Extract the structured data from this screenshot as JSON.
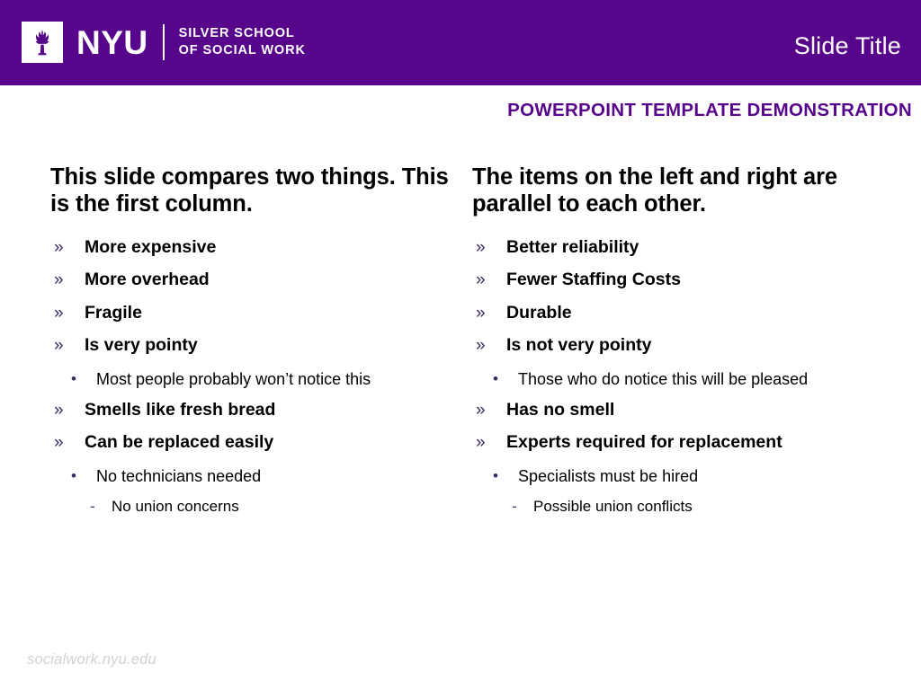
{
  "header": {
    "brand_word": "NYU",
    "school_line1": "SILVER SCHOOL",
    "school_line2": "OF SOCIAL WORK",
    "slide_title": "Slide Title",
    "bar_color": "#57068C"
  },
  "subtitle": "POWERPOINT TEMPLATE DEMONSTRATION",
  "columns": {
    "left": {
      "heading": "This slide compares two things. This is the first column.",
      "items": [
        {
          "level": 1,
          "marker": "»",
          "text": "More expensive"
        },
        {
          "level": 1,
          "marker": "»",
          "text": "More overhead"
        },
        {
          "level": 1,
          "marker": "»",
          "text": "Fragile"
        },
        {
          "level": 1,
          "marker": "»",
          "text": "Is very pointy"
        },
        {
          "level": 2,
          "marker": "•",
          "text": "Most people probably won’t notice this"
        },
        {
          "level": 1,
          "marker": "»",
          "text": "Smells like fresh bread"
        },
        {
          "level": 1,
          "marker": "»",
          "text": "Can be replaced easily"
        },
        {
          "level": 2,
          "marker": "•",
          "text": "No technicians needed"
        },
        {
          "level": 3,
          "marker": "-",
          "text": "No union concerns"
        }
      ]
    },
    "right": {
      "heading": "The items on the left and right are parallel to each other.",
      "items": [
        {
          "level": 1,
          "marker": "»",
          "text": "Better reliability"
        },
        {
          "level": 1,
          "marker": "»",
          "text": "Fewer Staffing Costs"
        },
        {
          "level": 1,
          "marker": "»",
          "text": "Durable"
        },
        {
          "level": 1,
          "marker": "»",
          "text": "Is not very pointy"
        },
        {
          "level": 2,
          "marker": "•",
          "text": "Those who do notice this will be pleased"
        },
        {
          "level": 1,
          "marker": "»",
          "text": "Has no smell"
        },
        {
          "level": 1,
          "marker": "»",
          "text": "Experts required for replacement"
        },
        {
          "level": 2,
          "marker": "•",
          "text": "Specialists must be hired"
        },
        {
          "level": 3,
          "marker": "-",
          "text": "Possible union conflicts"
        }
      ]
    }
  },
  "footer": {
    "url": "socialwork.nyu.edu"
  },
  "colors": {
    "nyu_violet": "#57068C",
    "marker_purple": "#3B2A5E",
    "footer_gray": "#D2D2D2"
  }
}
